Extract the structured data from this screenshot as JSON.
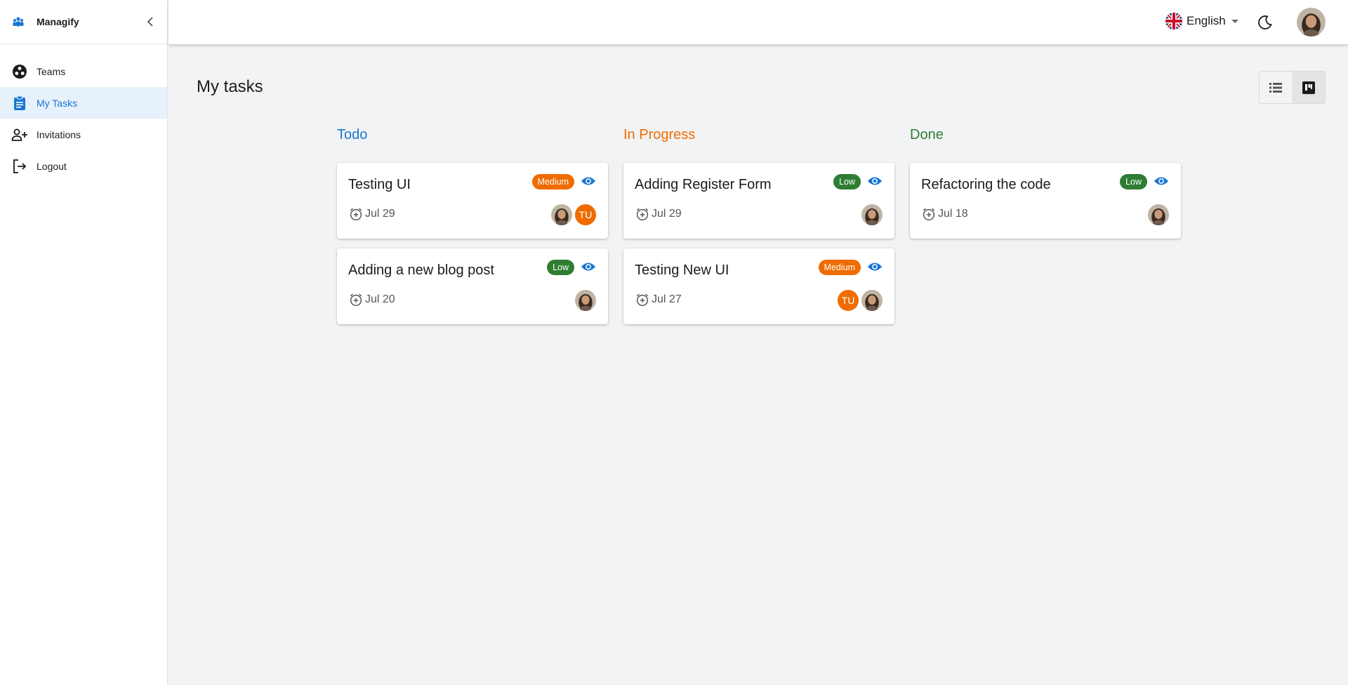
{
  "app": {
    "name": "Managify"
  },
  "sidebar": {
    "items": [
      {
        "label": "Teams",
        "icon": "teams-icon",
        "active": false
      },
      {
        "label": "My Tasks",
        "icon": "clipboard-icon",
        "active": true
      },
      {
        "label": "Invitations",
        "icon": "person-add-icon",
        "active": false
      },
      {
        "label": "Logout",
        "icon": "logout-icon",
        "active": false
      }
    ]
  },
  "header": {
    "language": "English"
  },
  "page": {
    "title": "My tasks"
  },
  "colors": {
    "accent": "#1976d2",
    "todo": "#1976d2",
    "in_progress": "#ef6c00",
    "done": "#2e7d32",
    "medium": "#ef6c00",
    "low": "#2e7d32"
  },
  "columns": [
    {
      "title": "Todo",
      "cards": [
        {
          "title": "Testing UI",
          "priority": "Medium",
          "date": "Jul 29",
          "assignees": [
            "photo",
            "TU"
          ]
        },
        {
          "title": "Adding a new blog post",
          "priority": "Low",
          "date": "Jul 20",
          "assignees": [
            "photo"
          ]
        }
      ]
    },
    {
      "title": "In Progress",
      "cards": [
        {
          "title": "Adding Register Form",
          "priority": "Low",
          "date": "Jul 29",
          "assignees": [
            "photo"
          ]
        },
        {
          "title": "Testing New UI",
          "priority": "Medium",
          "date": "Jul 27",
          "assignees": [
            "TU",
            "photo"
          ]
        }
      ]
    },
    {
      "title": "Done",
      "cards": [
        {
          "title": "Refactoring the code",
          "priority": "Low",
          "date": "Jul 18",
          "assignees": [
            "photo"
          ]
        }
      ]
    }
  ]
}
